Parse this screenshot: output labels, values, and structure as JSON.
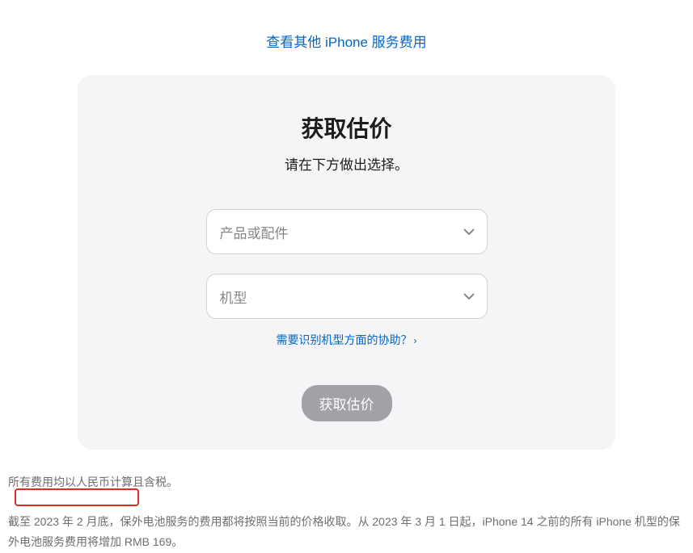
{
  "topLink": {
    "label": "查看其他 iPhone 服务费用"
  },
  "card": {
    "title": "获取估价",
    "subtitle": "请在下方做出选择。",
    "select1": {
      "placeholder": "产品或配件"
    },
    "select2": {
      "placeholder": "机型"
    },
    "helpLink": {
      "label": "需要识别机型方面的协助？"
    },
    "submit": {
      "label": "获取估价"
    }
  },
  "footnotes": {
    "note1": "所有费用均以人民币计算且含税。",
    "note2": "截至 2023 年 2 月底，保外电池服务的费用都将按照当前的价格收取。从 2023 年 3 月 1 日起，iPhone 14 之前的所有 iPhone 机型的保外电池服务费用将增加 RMB 169。"
  }
}
